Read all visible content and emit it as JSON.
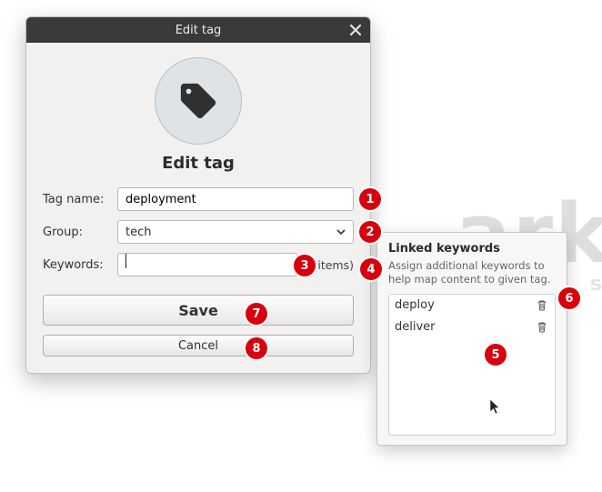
{
  "watermark": {
    "main": "ark",
    "sub": "s"
  },
  "dialog": {
    "window_title": "Edit tag",
    "heading": "Edit tag",
    "labels": {
      "tag_name": "Tag name:",
      "group": "Group:",
      "keywords": "Keywords:"
    },
    "values": {
      "tag_name": "deployment",
      "group": "tech",
      "keywords": ""
    },
    "keywords_count_text": "(2 items)",
    "buttons": {
      "save": "Save",
      "cancel": "Cancel"
    }
  },
  "popover": {
    "title": "Linked keywords",
    "description": "Assign additional keywords to help map content to given tag.",
    "items": [
      "deploy",
      "deliver"
    ]
  },
  "badges": {
    "1": "1",
    "2": "2",
    "3": "3",
    "4": "4",
    "5": "5",
    "6": "6",
    "7": "7",
    "8": "8"
  }
}
